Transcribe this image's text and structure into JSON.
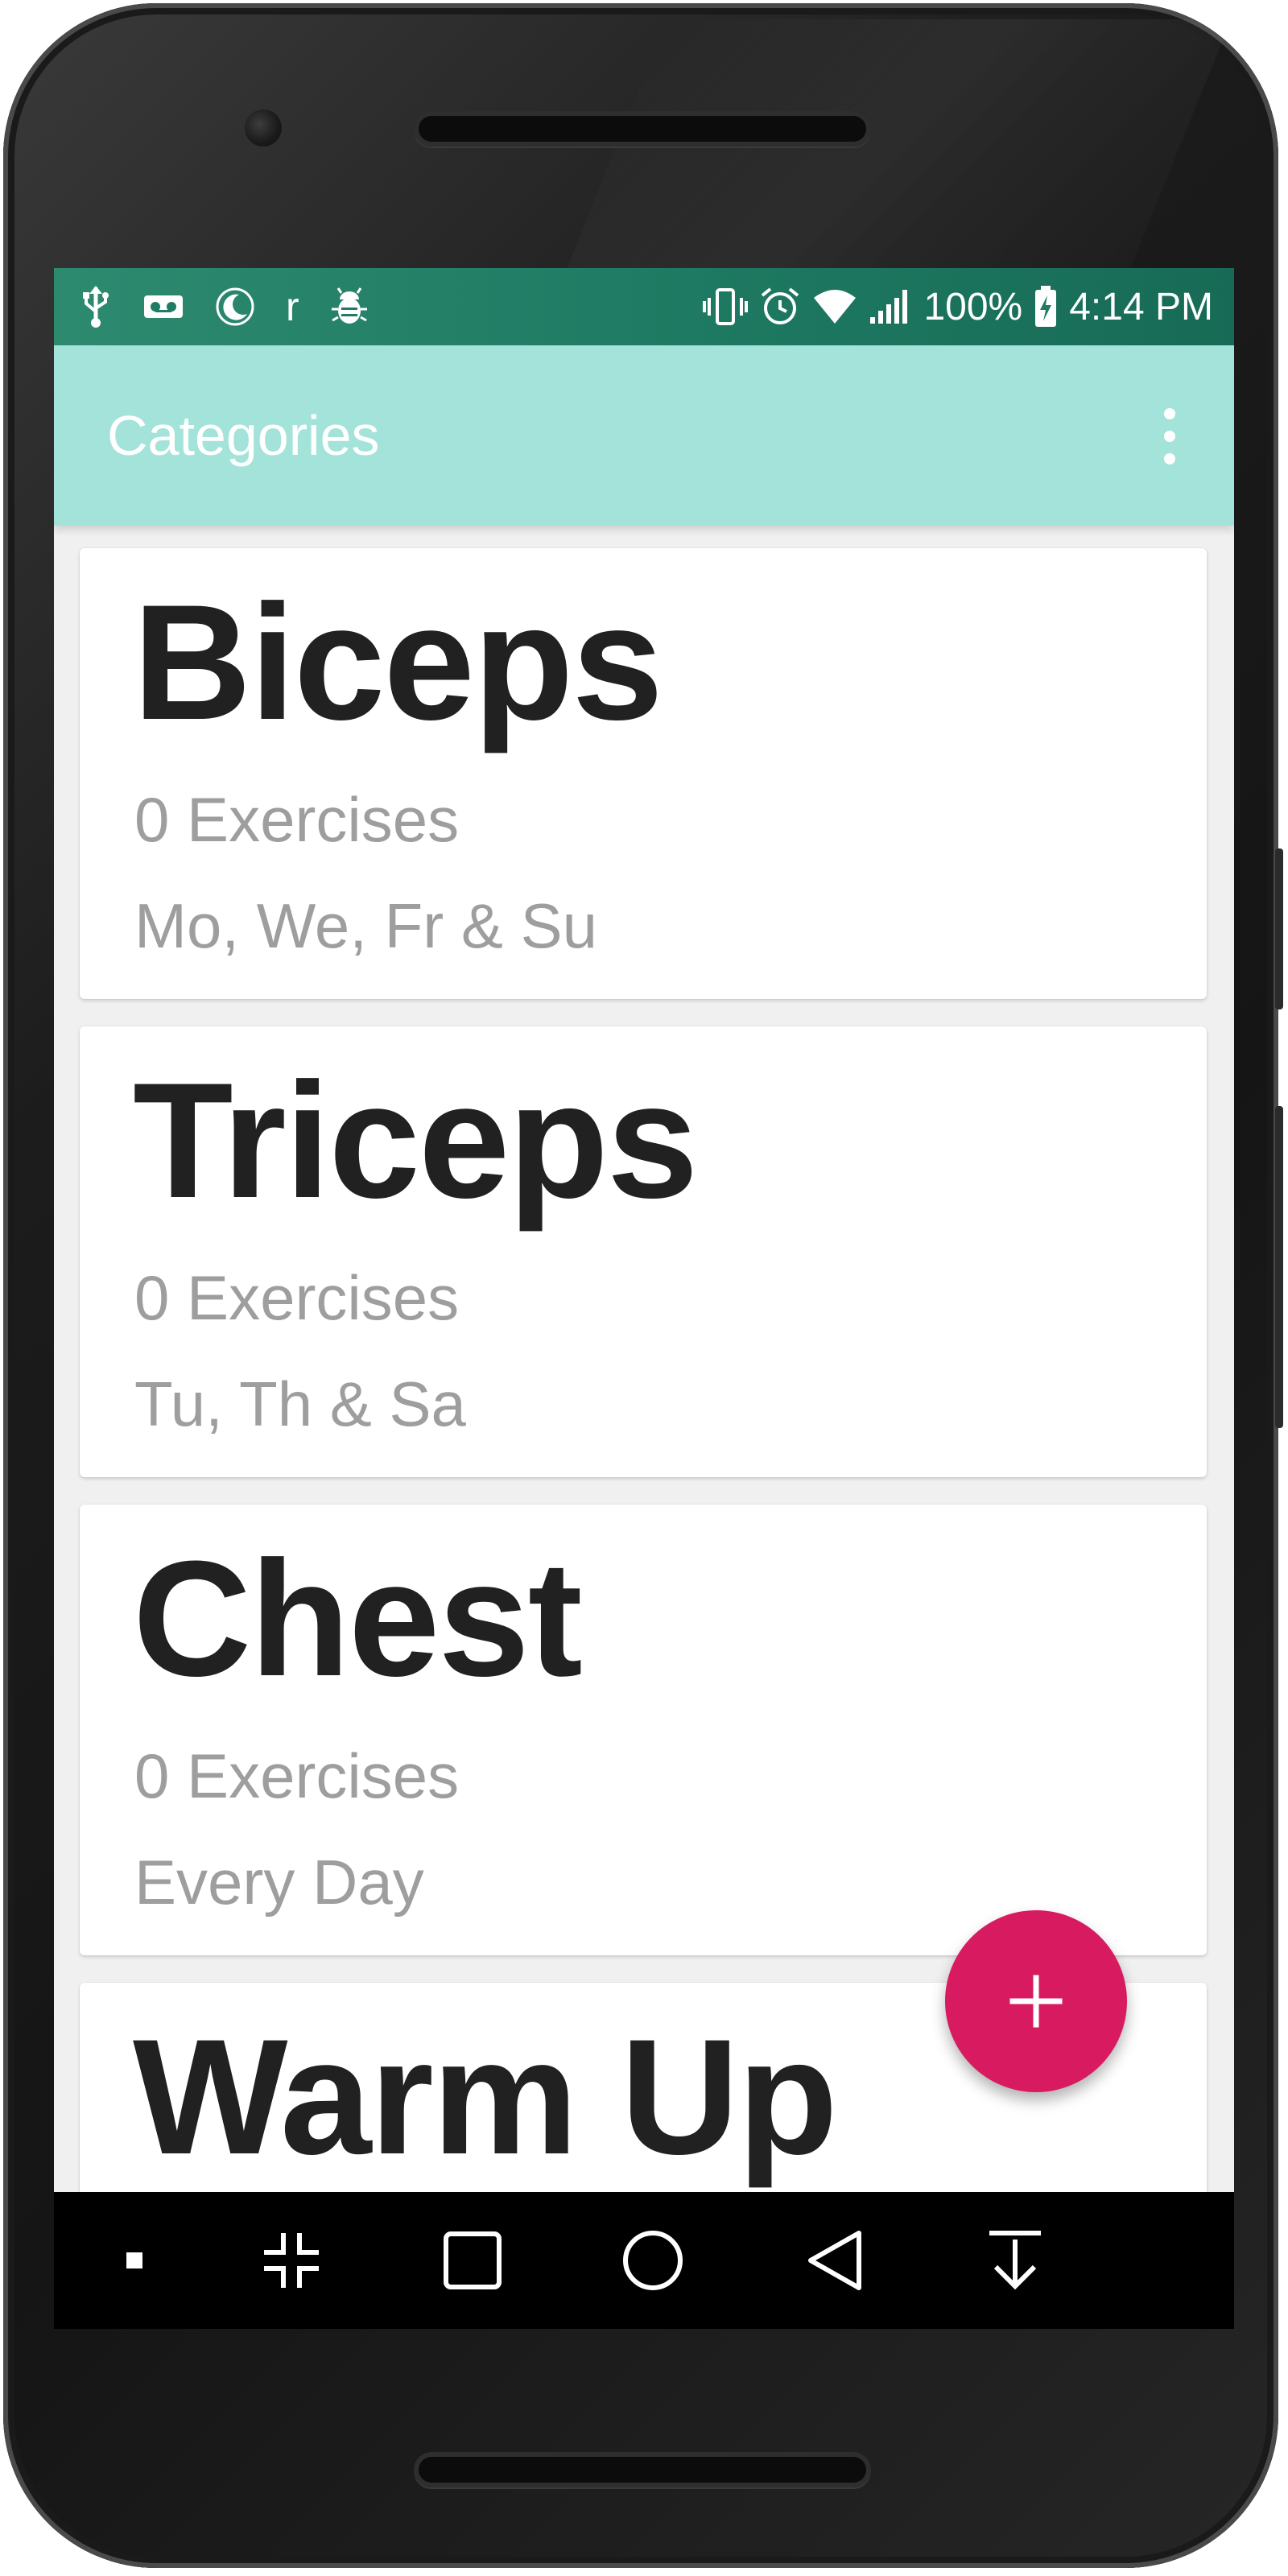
{
  "status_bar": {
    "left_letter": "r",
    "battery_percent": "100%",
    "time": "4:14 PM",
    "icons_left": [
      "usb-icon",
      "voicemail-icon",
      "moon-icon",
      "r-letter",
      "bug-icon"
    ],
    "icons_right": [
      "vibrate-icon",
      "alarm-icon",
      "wifi-icon",
      "signal-icon",
      "battery-charging-icon"
    ]
  },
  "app_bar": {
    "title": "Categories",
    "menu_icon": "more-vert-icon",
    "color": "#a4e3d9"
  },
  "categories": [
    {
      "name": "Biceps",
      "count": "0 Exercises",
      "days": "Mo, We, Fr & Su"
    },
    {
      "name": "Triceps",
      "count": "0 Exercises",
      "days": "Tu, Th & Sa"
    },
    {
      "name": "Chest",
      "count": "0 Exercises",
      "days": "Every Day"
    },
    {
      "name": "Warm Up",
      "count": "",
      "days": ""
    }
  ],
  "fab": {
    "icon": "add-icon",
    "color": "#d81b60"
  },
  "nav_bar": {
    "icons": [
      "small-square-icon",
      "collapse-icon",
      "recents-icon",
      "home-icon",
      "back-icon",
      "download-icon"
    ]
  }
}
